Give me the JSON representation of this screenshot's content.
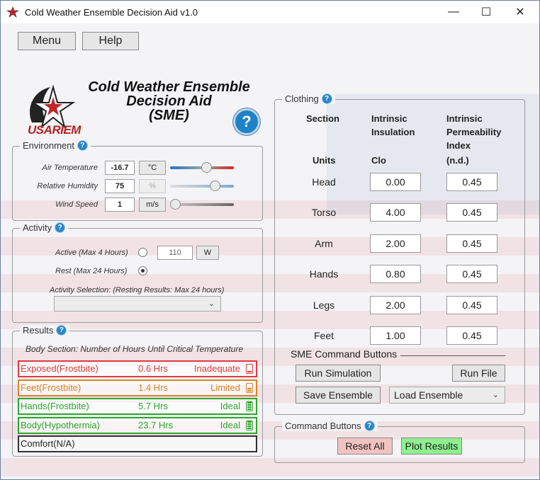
{
  "window": {
    "title": "Cold Weather Ensemble Decision Aid v1.0",
    "minimize_glyph": "—",
    "maximize_glyph": "☐",
    "close_glyph": "✕"
  },
  "menu": {
    "menu_label": "Menu",
    "help_label": "Help"
  },
  "header": {
    "title_line1": "Cold Weather Ensemble",
    "title_line2": "Decision Aid",
    "title_line3": "(SME)",
    "logo_text": "USARIEM",
    "help_glyph": "?"
  },
  "environment": {
    "label": "Environment",
    "rows": [
      {
        "label": "Air Temperature",
        "value": "-16.7",
        "unit": "°C",
        "unit_enabled": true,
        "slider_fraction": 0.58,
        "track": "temp"
      },
      {
        "label": "Relative Humidity",
        "value": "75",
        "unit": "%",
        "unit_enabled": false,
        "slider_fraction": 0.75,
        "track": "humid"
      },
      {
        "label": "Wind Speed",
        "value": "1",
        "unit": "m/s",
        "unit_enabled": true,
        "slider_fraction": 0.0,
        "track": "wind"
      }
    ]
  },
  "activity": {
    "label": "Activity",
    "active_label": "Active (Max 4 Hours)",
    "active_value": "110",
    "active_unit": "W",
    "rest_label": "Rest (Max 24 Hours)",
    "selection_label": "Activity Selection:  (Resting Results: Max 24 hours)",
    "selection_value": ""
  },
  "results": {
    "label": "Results",
    "subtitle": "Body Section: Number of Hours Until Critical Temperature",
    "rows": [
      {
        "name": "Exposed(Frostbite)",
        "hours": "0.6 Hrs",
        "status": "Inadequate",
        "level": "red"
      },
      {
        "name": "Feet(Frostbite)",
        "hours": "1.4 Hrs",
        "status": "Limited",
        "level": "orange"
      },
      {
        "name": "Hands(Frostbite)",
        "hours": "5.7 Hrs",
        "status": "Ideal",
        "level": "green"
      },
      {
        "name": "Body(Hypothermia)",
        "hours": "23.7 Hrs",
        "status": "Ideal",
        "level": "green"
      },
      {
        "name": "Comfort(N/A)",
        "hours": "",
        "status": "",
        "level": "none"
      }
    ]
  },
  "clothing": {
    "label": "Clothing",
    "col_section": "Section",
    "col_insulation": "Intrinsic Insulation",
    "col_permeability": "Intrinsic Permeability Index",
    "units_label": "Units",
    "units_insulation": "Clo",
    "units_permeability": "(n.d.)",
    "rows": [
      {
        "section": "Head",
        "insulation": "0.00",
        "permeability": "0.45"
      },
      {
        "section": "Torso",
        "insulation": "4.00",
        "permeability": "0.45"
      },
      {
        "section": "Arm",
        "insulation": "2.00",
        "permeability": "0.45"
      },
      {
        "section": "Hands",
        "insulation": "0.80",
        "permeability": "0.45"
      },
      {
        "section": "Legs",
        "insulation": "2.00",
        "permeability": "0.45"
      },
      {
        "section": "Feet",
        "insulation": "1.00",
        "permeability": "0.45"
      }
    ],
    "sme_label": "SME Command Buttons",
    "run_simulation": "Run Simulation",
    "run_file": "Run File",
    "save_ensemble": "Save Ensemble",
    "load_ensemble": "Load Ensemble"
  },
  "commands": {
    "label": "Command Buttons",
    "reset_all": "Reset All",
    "plot_results": "Plot Results"
  },
  "colors": {
    "red": "#e0393f",
    "orange": "#d9822b",
    "green": "#2aa62a",
    "accent_blue": "#2a86c9",
    "plot_green": "#8ef08e",
    "reset_red": "#f2c2c2"
  }
}
